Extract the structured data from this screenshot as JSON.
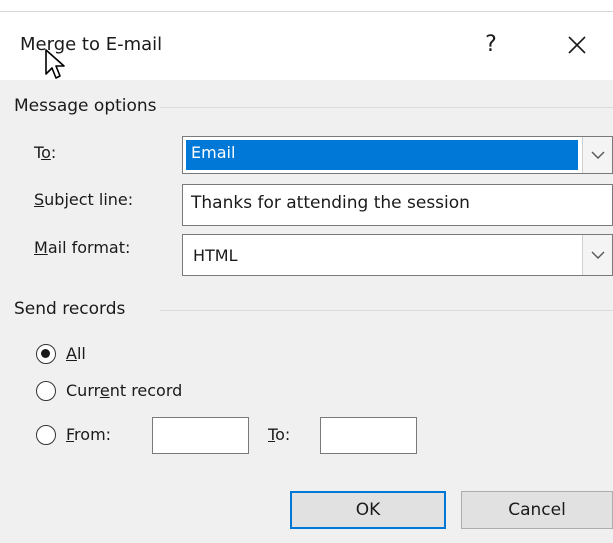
{
  "dialog": {
    "title": "Merge to E-mail",
    "help_label": "?",
    "close_icon": "close-icon"
  },
  "message_options": {
    "group_title": "Message options",
    "to": {
      "label_prefix": "T",
      "label_underlined": "o",
      "label_suffix": ":",
      "value": "Email"
    },
    "subject": {
      "label_underlined": "S",
      "label_rest": "ubject line:",
      "value": "Thanks for attending the session"
    },
    "mail_format": {
      "label_underlined": "M",
      "label_rest": "ail format:",
      "value": "HTML"
    }
  },
  "send_records": {
    "group_title": "Send records",
    "all": {
      "underlined": "A",
      "rest": "ll",
      "checked": true
    },
    "current": {
      "prefix": "Curr",
      "underlined": "e",
      "rest": "nt record",
      "checked": false
    },
    "from": {
      "underlined": "F",
      "rest": "rom:",
      "checked": false,
      "value": ""
    },
    "to": {
      "underlined": "T",
      "rest": "o:",
      "value": ""
    }
  },
  "buttons": {
    "ok_label": "OK",
    "cancel_label": "Cancel"
  },
  "colors": {
    "accent": "#0078d7",
    "background": "#f0f0f0"
  }
}
